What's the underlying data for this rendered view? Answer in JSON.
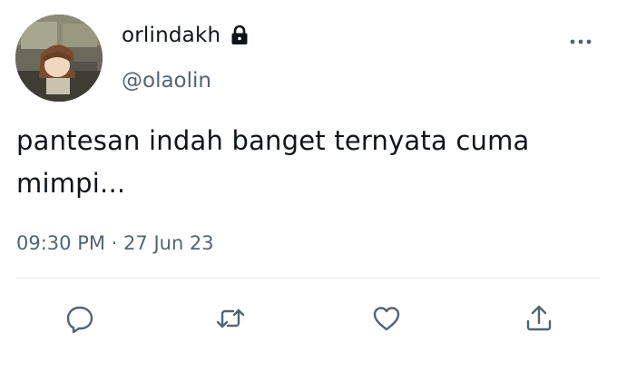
{
  "user": {
    "display_name": "orlindakh",
    "handle": "@olaolin",
    "protected_icon": "lock-icon",
    "avatar": "anime-avatar"
  },
  "tweet": {
    "text": "pantesan indah banget ternyata cuma mimpi...",
    "time": "09:30 PM",
    "separator": "·",
    "date": "27 Jun 23"
  },
  "actions": [
    {
      "name": "reply",
      "icon": "reply-icon"
    },
    {
      "name": "retweet",
      "icon": "retweet-icon"
    },
    {
      "name": "like",
      "icon": "heart-icon"
    },
    {
      "name": "share",
      "icon": "share-icon"
    }
  ],
  "colors": {
    "text_primary": "#0f1419",
    "text_secondary": "#536471",
    "divider": "#e6e9eb"
  }
}
